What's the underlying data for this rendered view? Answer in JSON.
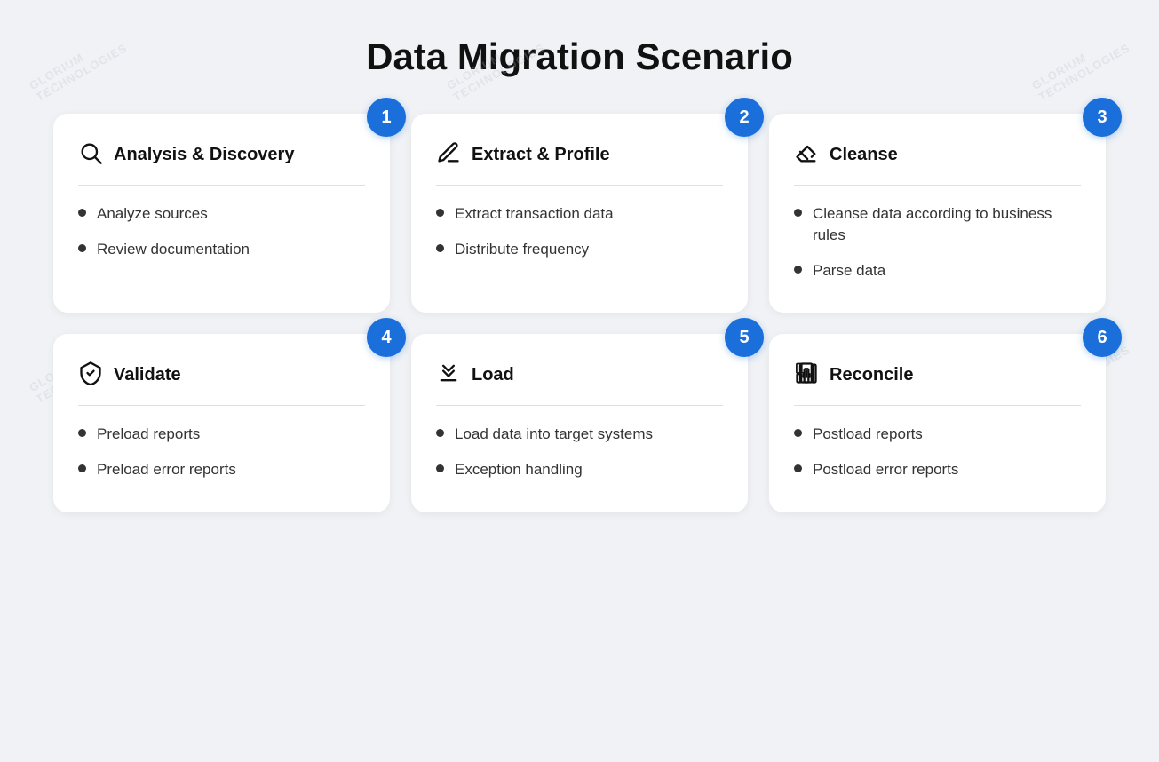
{
  "page": {
    "title": "Data Migration Scenario",
    "watermark_text": "GLORIUM TECHNOLOGIES"
  },
  "cards": [
    {
      "id": "card-1",
      "badge": "1",
      "icon": "search",
      "title": "Analysis & Discovery",
      "items": [
        "Analyze sources",
        "Review documentation"
      ]
    },
    {
      "id": "card-2",
      "badge": "2",
      "icon": "edit",
      "title": "Extract & Profile",
      "items": [
        "Extract transaction data",
        "Distribute frequency"
      ]
    },
    {
      "id": "card-3",
      "badge": "3",
      "icon": "eraser",
      "title": "Cleanse",
      "items": [
        "Cleanse data according to business rules",
        "Parse data"
      ]
    },
    {
      "id": "card-4",
      "badge": "4",
      "icon": "shield-check",
      "title": "Validate",
      "items": [
        "Preload reports",
        "Preload error reports"
      ]
    },
    {
      "id": "card-5",
      "badge": "5",
      "icon": "download",
      "title": "Load",
      "items": [
        "Load data into target systems",
        "Exception handling"
      ]
    },
    {
      "id": "card-6",
      "badge": "6",
      "icon": "bar-chart",
      "title": "Reconcile",
      "items": [
        "Postload reports",
        "Postload error reports"
      ]
    }
  ]
}
